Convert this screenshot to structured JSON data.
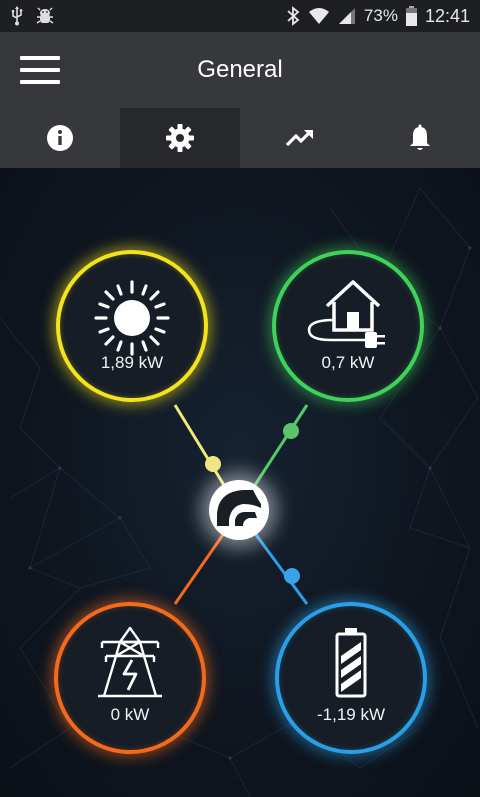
{
  "status_bar": {
    "battery_percent": "73%",
    "time": "12:41",
    "icons": [
      "usb-icon",
      "android-debug-icon",
      "bluetooth-icon",
      "wifi-icon",
      "cell-signal-icon",
      "battery-icon"
    ]
  },
  "app_bar": {
    "title": "General",
    "menu_icon": "hamburger-menu-icon"
  },
  "tabs": [
    {
      "icon": "info-icon",
      "active": false
    },
    {
      "icon": "gear-icon",
      "active": true
    },
    {
      "icon": "trending-up-icon",
      "active": false
    },
    {
      "icon": "bell-icon",
      "active": false
    }
  ],
  "energy_flow": {
    "solar": {
      "value": "1,89 kW",
      "icon": "sun-icon",
      "color": "#f2e31c"
    },
    "house": {
      "value": "0,7 kW",
      "icon": "house-plug-icon",
      "color": "#3fd15a"
    },
    "grid": {
      "value": "0 kW",
      "icon": "power-pylon-icon",
      "color": "#f26a1c"
    },
    "battery": {
      "value": "-1,19 kW",
      "icon": "battery-charging-icon",
      "color": "#2a9fe6"
    },
    "hub": {
      "icon": "inverter-logo-icon"
    }
  }
}
